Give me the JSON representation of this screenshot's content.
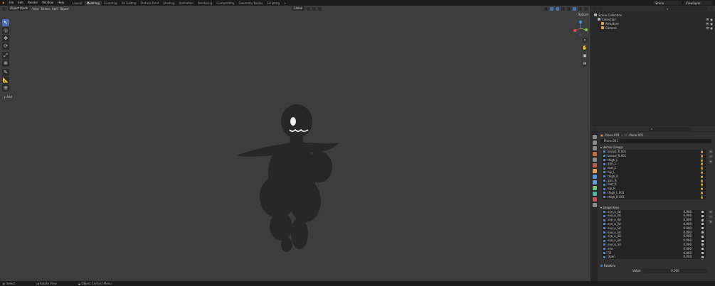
{
  "menu": [
    "File",
    "Edit",
    "Render",
    "Window",
    "Help"
  ],
  "workspaces": [
    "Layout",
    "Modeling",
    "Sculpting",
    "UV Editing",
    "Texture Paint",
    "Shading",
    "Animation",
    "Rendering",
    "Compositing",
    "Geometry Nodes",
    "Scripting",
    "+"
  ],
  "active_workspace_index": 1,
  "scene": "Scene",
  "view_layer": "ViewLayer",
  "viewport": {
    "mode": "Object Mode",
    "menus": [
      "View",
      "Select",
      "Add",
      "Object"
    ],
    "orientation": "Global",
    "options_label": "Options",
    "add_operator_label": "Add",
    "tools": [
      "↖",
      "◎",
      "✥",
      "⟳",
      "⤢",
      "⊕",
      "✎",
      "📐",
      "⊞"
    ],
    "background_color": "#3d3d3d"
  },
  "outliner": {
    "rows": [
      {
        "label": "Scene Collection",
        "indent": 0,
        "color": "#b0b0b0"
      },
      {
        "label": "Collection",
        "indent": 1,
        "color": "#b0b0b0"
      },
      {
        "label": "Armature",
        "indent": 2,
        "color": "#e79f55"
      },
      {
        "label": "Camera",
        "indent": 2,
        "color": "#e79f55"
      }
    ]
  },
  "properties": {
    "breadcrumb": [
      "Plane.001",
      "Plane.001"
    ],
    "mesh_name": "Plane.001",
    "vertex_groups_title": "Vertex Groups",
    "vertex_groups": [
      "breast_R.001",
      "breast_R.001",
      "thigh_L",
      "arm_L",
      "foot_L",
      "hip_L",
      "thigh_R",
      "arm_R",
      "foot_R",
      "hip_R",
      "thigh_L.001",
      "thigh_R.001"
    ],
    "shape_keys_title": "Shape Keys",
    "shape_keys": [
      {
        "name": "eye_u_lid",
        "value": "0.000"
      },
      {
        "name": "eye_u_lid",
        "value": "0.000"
      },
      {
        "name": "eye_u_lid",
        "value": "0.000"
      },
      {
        "name": "eye_u_lid",
        "value": "0.000"
      },
      {
        "name": "eye_u_lid",
        "value": "0.000"
      },
      {
        "name": "eye_u_lid",
        "value": "0.000"
      },
      {
        "name": "eye_u_lid",
        "value": "0.000"
      },
      {
        "name": "eye_u_lid",
        "value": "0.000"
      },
      {
        "name": "eye_u_lid",
        "value": "0.000"
      },
      {
        "name": "eye",
        "value": "0.000"
      },
      {
        "name": "Fill",
        "value": "0.000"
      },
      {
        "name": "Open",
        "value": "0.000"
      }
    ],
    "relative_label": "Relative",
    "value_label": "Value",
    "value": "0.000"
  },
  "statusbar": {
    "items": [
      "Select",
      "Rotate View",
      "Object Context Menu"
    ],
    "version": ""
  },
  "colors": {
    "accent": "#4772b3",
    "figure": "#272727"
  }
}
